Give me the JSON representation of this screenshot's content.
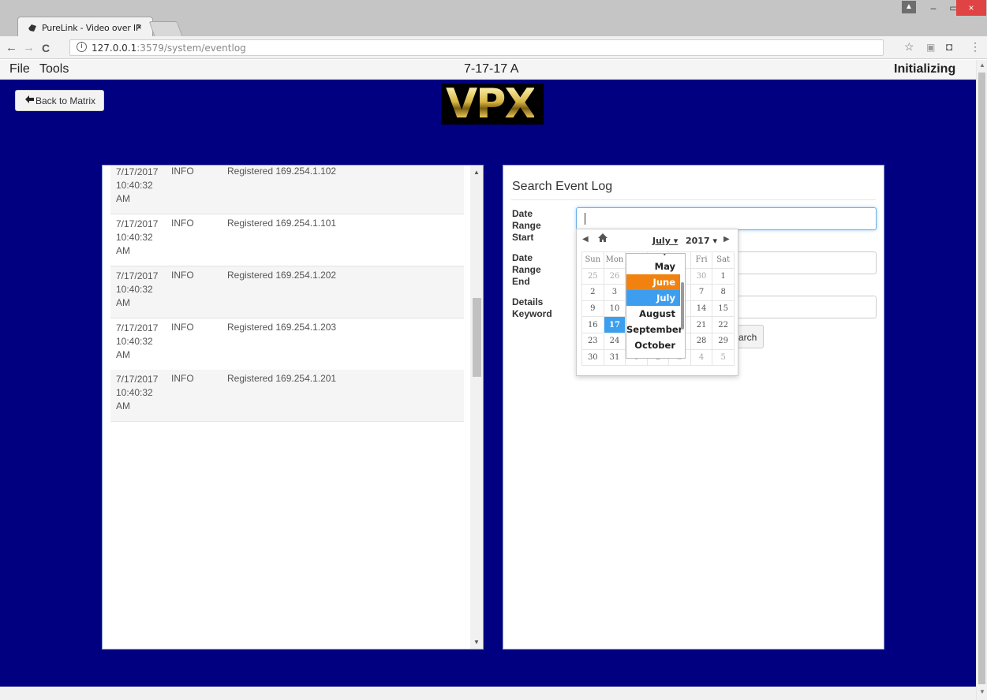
{
  "browser": {
    "tab_title": "PureLink - Video over IP",
    "tab_close": "×",
    "url_host": "127.0.0.1",
    "url_path": ":3579/system/eventlog",
    "back": "←",
    "forward": "→",
    "reload": "C",
    "info_icon": "i",
    "star": "☆",
    "ext1": "▣",
    "ext2": "◘",
    "menu": "⋮",
    "win_user": "▲",
    "win_min": "–",
    "win_max": "▭",
    "win_close": "×"
  },
  "appbar": {
    "menu_file": "File",
    "menu_tools": "Tools",
    "title": "7-17-17 A",
    "status": "Initializing"
  },
  "main": {
    "back_button": "Back to Matrix",
    "back_arrow": "🡐",
    "logo_text": "VPX"
  },
  "event_log": {
    "rows": [
      {
        "date": "7/17/2017",
        "time": "10:40:32",
        "ampm": "AM",
        "level": "INFO",
        "message": "Registered 169.254.1.102"
      },
      {
        "date": "7/17/2017",
        "time": "10:40:32",
        "ampm": "AM",
        "level": "INFO",
        "message": "Registered 169.254.1.101"
      },
      {
        "date": "7/17/2017",
        "time": "10:40:32",
        "ampm": "AM",
        "level": "INFO",
        "message": "Registered 169.254.1.202"
      },
      {
        "date": "7/17/2017",
        "time": "10:40:32",
        "ampm": "AM",
        "level": "INFO",
        "message": "Registered 169.254.1.203"
      },
      {
        "date": "7/17/2017",
        "time": "10:40:32",
        "ampm": "AM",
        "level": "INFO",
        "message": "Registered 169.254.1.201"
      }
    ],
    "scroll_up": "▲",
    "scroll_down": "▼"
  },
  "search": {
    "title": "Search Event Log",
    "start_label": "Date Range Start",
    "end_label": "Date Range End",
    "keyword_label": "Details Keyword",
    "search_button_visible": "arch"
  },
  "datepicker": {
    "prev": "◀",
    "home": "⌂",
    "month": "July",
    "year": "2017",
    "next": "▶",
    "weekdays_visible": [
      "Sun",
      "Mon",
      "",
      "",
      "u",
      "Fri",
      "Sat"
    ],
    "weeks": [
      [
        "25",
        "26",
        "",
        "",
        "9",
        "30",
        "1"
      ],
      [
        "2",
        "3",
        "",
        "",
        "6",
        "7",
        "8"
      ],
      [
        "9",
        "10",
        "",
        "",
        "3",
        "14",
        "15"
      ],
      [
        "16",
        "17",
        "",
        "",
        "0",
        "21",
        "22"
      ],
      [
        "23",
        "24",
        "",
        "",
        "7",
        "28",
        "29"
      ],
      [
        "30",
        "31",
        "1",
        "2",
        "3",
        "4",
        "5"
      ]
    ],
    "selected_day": "17",
    "month_options": [
      "May",
      "June",
      "July",
      "August",
      "September",
      "October"
    ],
    "highlighted_month": "June",
    "selected_month": "July",
    "colors": {
      "highlight": "#f2820f",
      "selected": "#3d9ef0"
    }
  }
}
